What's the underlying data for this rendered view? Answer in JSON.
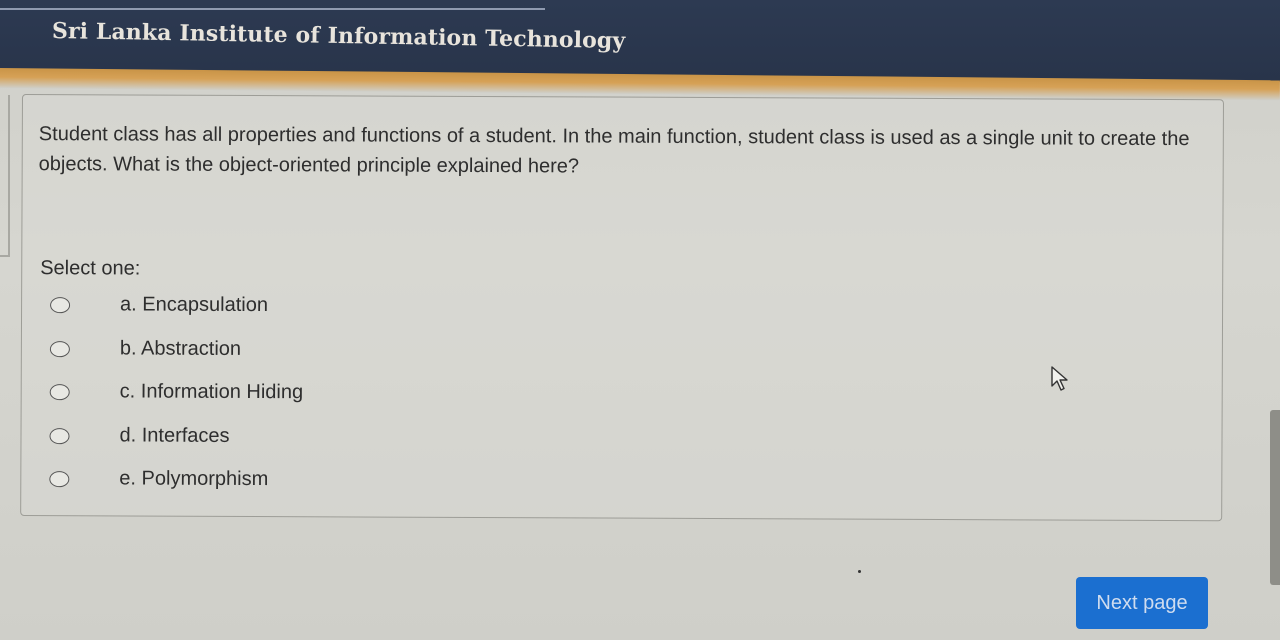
{
  "header": {
    "title": "Sri Lanka Institute of Information Technology"
  },
  "question": {
    "text": "Student class has all properties and functions of a student. In the main function, student class is used as a single unit to create the objects. What is the object-oriented principle explained here?",
    "select_label": "Select one:",
    "options": [
      {
        "label": "a. Encapsulation"
      },
      {
        "label": "b. Abstraction"
      },
      {
        "label": "c. Information Hiding"
      },
      {
        "label": "d. Interfaces"
      },
      {
        "label": "e. Polymorphism"
      }
    ]
  },
  "footer": {
    "next_label": "Next page"
  },
  "icons": {
    "cursor": "mouse-pointer-icon",
    "radio": "radio-unchecked-icon"
  },
  "colors": {
    "header_bg": "#2b3750",
    "accent": "#d19c52",
    "button_bg": "#1b6fd0",
    "button_text": "#cfdcef"
  }
}
